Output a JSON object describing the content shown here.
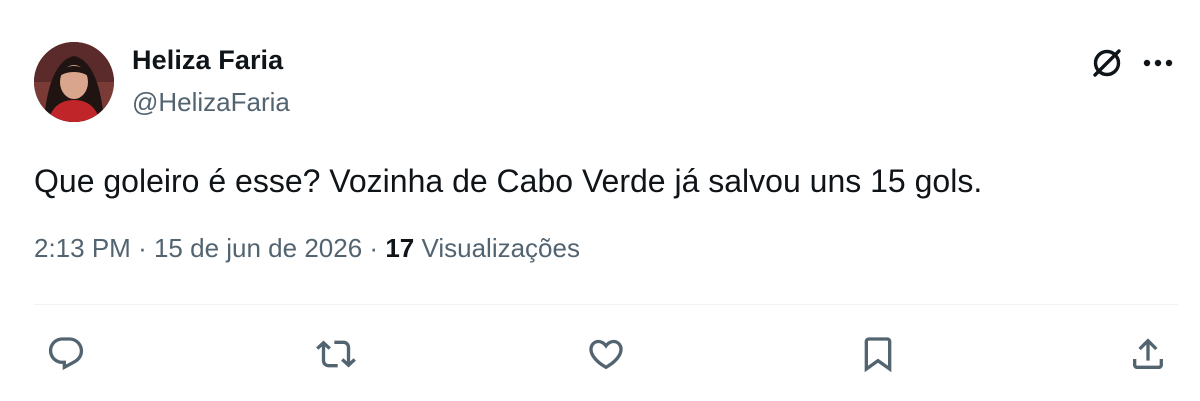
{
  "author": {
    "name": "Heliza Faria",
    "handle": "@HelizaFaria",
    "avatar": "profile-photo"
  },
  "tweet": {
    "text": "Que goleiro é esse? Vozinha de Cabo Verde já salvou uns 15 gols.",
    "time": "2:13 PM",
    "separator": "·",
    "date": "15 de jun de 2026",
    "views_count": "17",
    "views_label": "Visualizações"
  },
  "header_icons": [
    "grok-icon",
    "more-options-icon"
  ],
  "actions": [
    "reply-icon",
    "retweet-icon",
    "like-icon",
    "bookmark-icon",
    "share-icon"
  ],
  "colors": {
    "text": "#0f1419",
    "secondary": "#536471",
    "divider": "#eff3f4",
    "background": "#ffffff"
  }
}
